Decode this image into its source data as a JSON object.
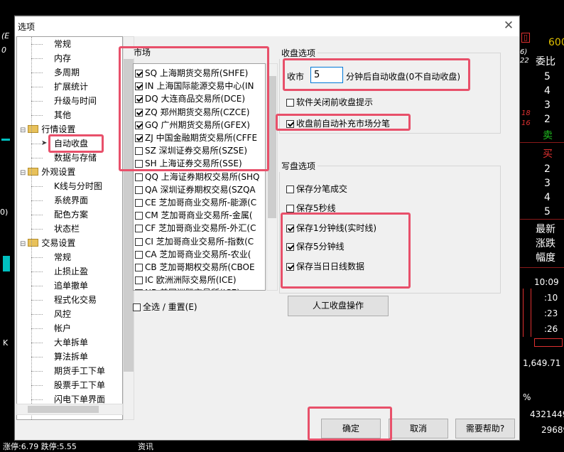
{
  "background": {
    "menu_glyph": "☰",
    "left_labels": [
      "(E",
      "0",
      "0)",
      "K"
    ],
    "right_top_value": "600",
    "right_title": "委比",
    "right_numbers_top": [
      "5",
      "4",
      "3",
      "2"
    ],
    "sell_label": "卖",
    "buy_label": "买",
    "right_numbers_bottom": [
      "2",
      "3",
      "4",
      "5"
    ],
    "latest_labels": [
      "最新",
      "涨跌",
      "幅度"
    ],
    "times": [
      "10:09",
      ":10",
      ":23",
      ":26"
    ],
    "bottom_price": "1,649.71",
    "bottom_pct": "%",
    "bottom_big": "4321449",
    "bottom_value": "29689",
    "bottom_status": "涨停:6.79 跌停:5.55",
    "bottom_tab": "资讯",
    "red_marks": [
      "18",
      "16"
    ],
    "side_marks": [
      "6)",
      "22"
    ]
  },
  "dialog": {
    "title": "选项",
    "close_glyph": "✕",
    "tree": [
      {
        "label": "常规",
        "level": 2
      },
      {
        "label": "内存",
        "level": 2
      },
      {
        "label": "多周期",
        "level": 2
      },
      {
        "label": "扩展统计",
        "level": 2
      },
      {
        "label": "升级与时间",
        "level": 2
      },
      {
        "label": "其他",
        "level": 2
      },
      {
        "label": "行情设置",
        "level": 1,
        "folder": true
      },
      {
        "label": "自动收盘",
        "level": 2,
        "selected": true
      },
      {
        "label": "数据与存储",
        "level": 2
      },
      {
        "label": "外观设置",
        "level": 1,
        "folder": true
      },
      {
        "label": "K线与分时图",
        "level": 2
      },
      {
        "label": "系统界面",
        "level": 2
      },
      {
        "label": "配色方案",
        "level": 2
      },
      {
        "label": "状态栏",
        "level": 2
      },
      {
        "label": "交易设置",
        "level": 1,
        "folder": true
      },
      {
        "label": "常规",
        "level": 2
      },
      {
        "label": "止损止盈",
        "level": 2
      },
      {
        "label": "追单撤单",
        "level": 2
      },
      {
        "label": "程式化交易",
        "level": 2
      },
      {
        "label": "风控",
        "level": 2
      },
      {
        "label": "帐户",
        "level": 2
      },
      {
        "label": "大单拆单",
        "level": 2
      },
      {
        "label": "算法拆单",
        "level": 2
      },
      {
        "label": "期货手工下单",
        "level": 2
      },
      {
        "label": "股票手工下单",
        "level": 2
      },
      {
        "label": "闪电下单界面",
        "level": 2
      }
    ],
    "market": {
      "label": "市场",
      "items": [
        {
          "label": "SQ 上海期货交易所(SHFE)",
          "checked": true
        },
        {
          "label": "IN 上海国际能源交易中心(IN",
          "checked": true
        },
        {
          "label": "DQ 大连商品交易所(DCE)",
          "checked": true
        },
        {
          "label": "ZQ 郑州期货交易所(CZCE)",
          "checked": true
        },
        {
          "label": "GQ 广州期货交易所(GFEX)",
          "checked": true
        },
        {
          "label": "ZJ 中国金融期货交易所(CFFE",
          "checked": true
        },
        {
          "label": "SZ 深圳证券交易所(SZSE)",
          "checked": false
        },
        {
          "label": "SH 上海证券交易所(SSE)",
          "checked": false
        },
        {
          "label": "QQ 上海证券期权交易所(SHQ",
          "checked": false
        },
        {
          "label": "QA 深圳证券期权交易(SZQA",
          "checked": false
        },
        {
          "label": "CE 芝加哥商业交易所-能源(C",
          "checked": false
        },
        {
          "label": "CM 芝加哥商业交易所-金属(",
          "checked": false
        },
        {
          "label": "CF 芝加哥商业交易所-外汇(C",
          "checked": false
        },
        {
          "label": "CI 芝加哥商业交易所-指数(C",
          "checked": false
        },
        {
          "label": "CA 芝加哥商业交易所-农业(",
          "checked": false
        },
        {
          "label": "CB 芝加哥期权交易所(CBOE",
          "checked": false
        },
        {
          "label": "IC 欧洲洲际交易所(ICE)",
          "checked": false
        },
        {
          "label": "NB 美国洲际交易所(ICE)",
          "checked": false
        }
      ],
      "select_all_label": "全选 / 重置(E)"
    },
    "close_options": {
      "label": "收盘选项",
      "prefix": "收市",
      "minutes_value": "5",
      "suffix": "分钟后自动收盘(0不自动收盘)",
      "prompt_label": "软件关闭前收盘提示",
      "prompt_checked": false,
      "fill_label": "收盘前自动补充市场分笔",
      "fill_checked": true
    },
    "write_options": {
      "label": "写盘选项",
      "items": [
        {
          "label": "保存分笔成交",
          "checked": false
        },
        {
          "label": "保存5秒线",
          "checked": false
        },
        {
          "label": "保存1分钟线(实时线)",
          "checked": true
        },
        {
          "label": "保存5分钟线",
          "checked": true
        },
        {
          "label": "保存当日日线数据",
          "checked": true
        }
      ],
      "manual_button": "人工收盘操作"
    },
    "buttons": {
      "ok": "确定",
      "cancel": "取消",
      "help": "需要帮助?"
    }
  }
}
